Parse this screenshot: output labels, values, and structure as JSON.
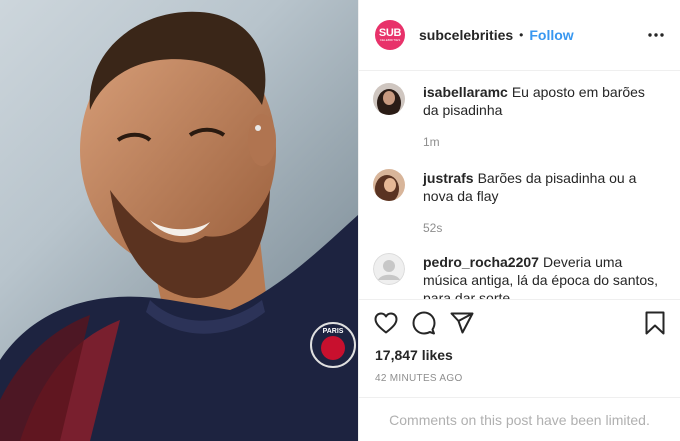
{
  "header": {
    "logo_text": "SUB",
    "logo_subtext": "CELEBRITIES",
    "username": "subcelebrities",
    "separator": "•",
    "follow_label": "Follow"
  },
  "photo": {
    "jersey_badge_text": "PARIS"
  },
  "comments": [
    {
      "username": "isabellaramc",
      "text": "Eu aposto em barões da pisadinha",
      "time": "1m"
    },
    {
      "username": "justrafs",
      "text": "Barões da pisadinha ou a nova da flay",
      "time": "52s"
    },
    {
      "username": "pedro_rocha2207",
      "text": "Deveria uma música antiga, lá da época do santos, para dar sorte"
    }
  ],
  "engagement": {
    "likes": "17,847 likes",
    "posted": "42 MINUTES AGO"
  },
  "footer": {
    "limited_notice": "Comments on this post have been limited."
  },
  "icons": {
    "heart": "heart-icon",
    "comment": "comment-icon",
    "share": "share-icon",
    "save": "bookmark-icon",
    "more": "more-options-icon"
  },
  "colors": {
    "brand_logo": "#e8326a",
    "follow": "#3897f0",
    "muted": "#8e8e8e",
    "jersey": "#1d2340"
  }
}
